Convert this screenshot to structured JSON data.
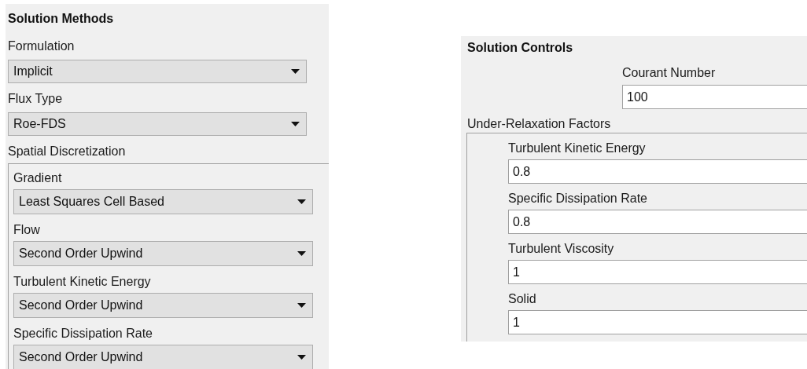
{
  "solution_methods": {
    "title": "Solution Methods",
    "fields": [
      {
        "label": "Formulation",
        "value": "Implicit"
      },
      {
        "label": "Flux Type",
        "value": "Roe-FDS"
      }
    ],
    "spatial_discretization": {
      "label": "Spatial Discretization",
      "fields": [
        {
          "label": "Gradient",
          "value": "Least Squares Cell Based"
        },
        {
          "label": "Flow",
          "value": "Second Order Upwind"
        },
        {
          "label": "Turbulent Kinetic Energy",
          "value": "Second Order Upwind"
        },
        {
          "label": "Specific Dissipation Rate",
          "value": "Second Order Upwind"
        }
      ]
    }
  },
  "solution_controls": {
    "title": "Solution Controls",
    "courant_number": {
      "label": "Courant Number",
      "value": "100"
    },
    "under_relaxation_factors": {
      "label": "Under-Relaxation Factors",
      "fields": [
        {
          "label": "Turbulent Kinetic Energy",
          "value": "0.8"
        },
        {
          "label": "Specific Dissipation Rate",
          "value": "0.8"
        },
        {
          "label": "Turbulent Viscosity",
          "value": "1"
        },
        {
          "label": "Solid",
          "value": "1"
        }
      ]
    }
  }
}
